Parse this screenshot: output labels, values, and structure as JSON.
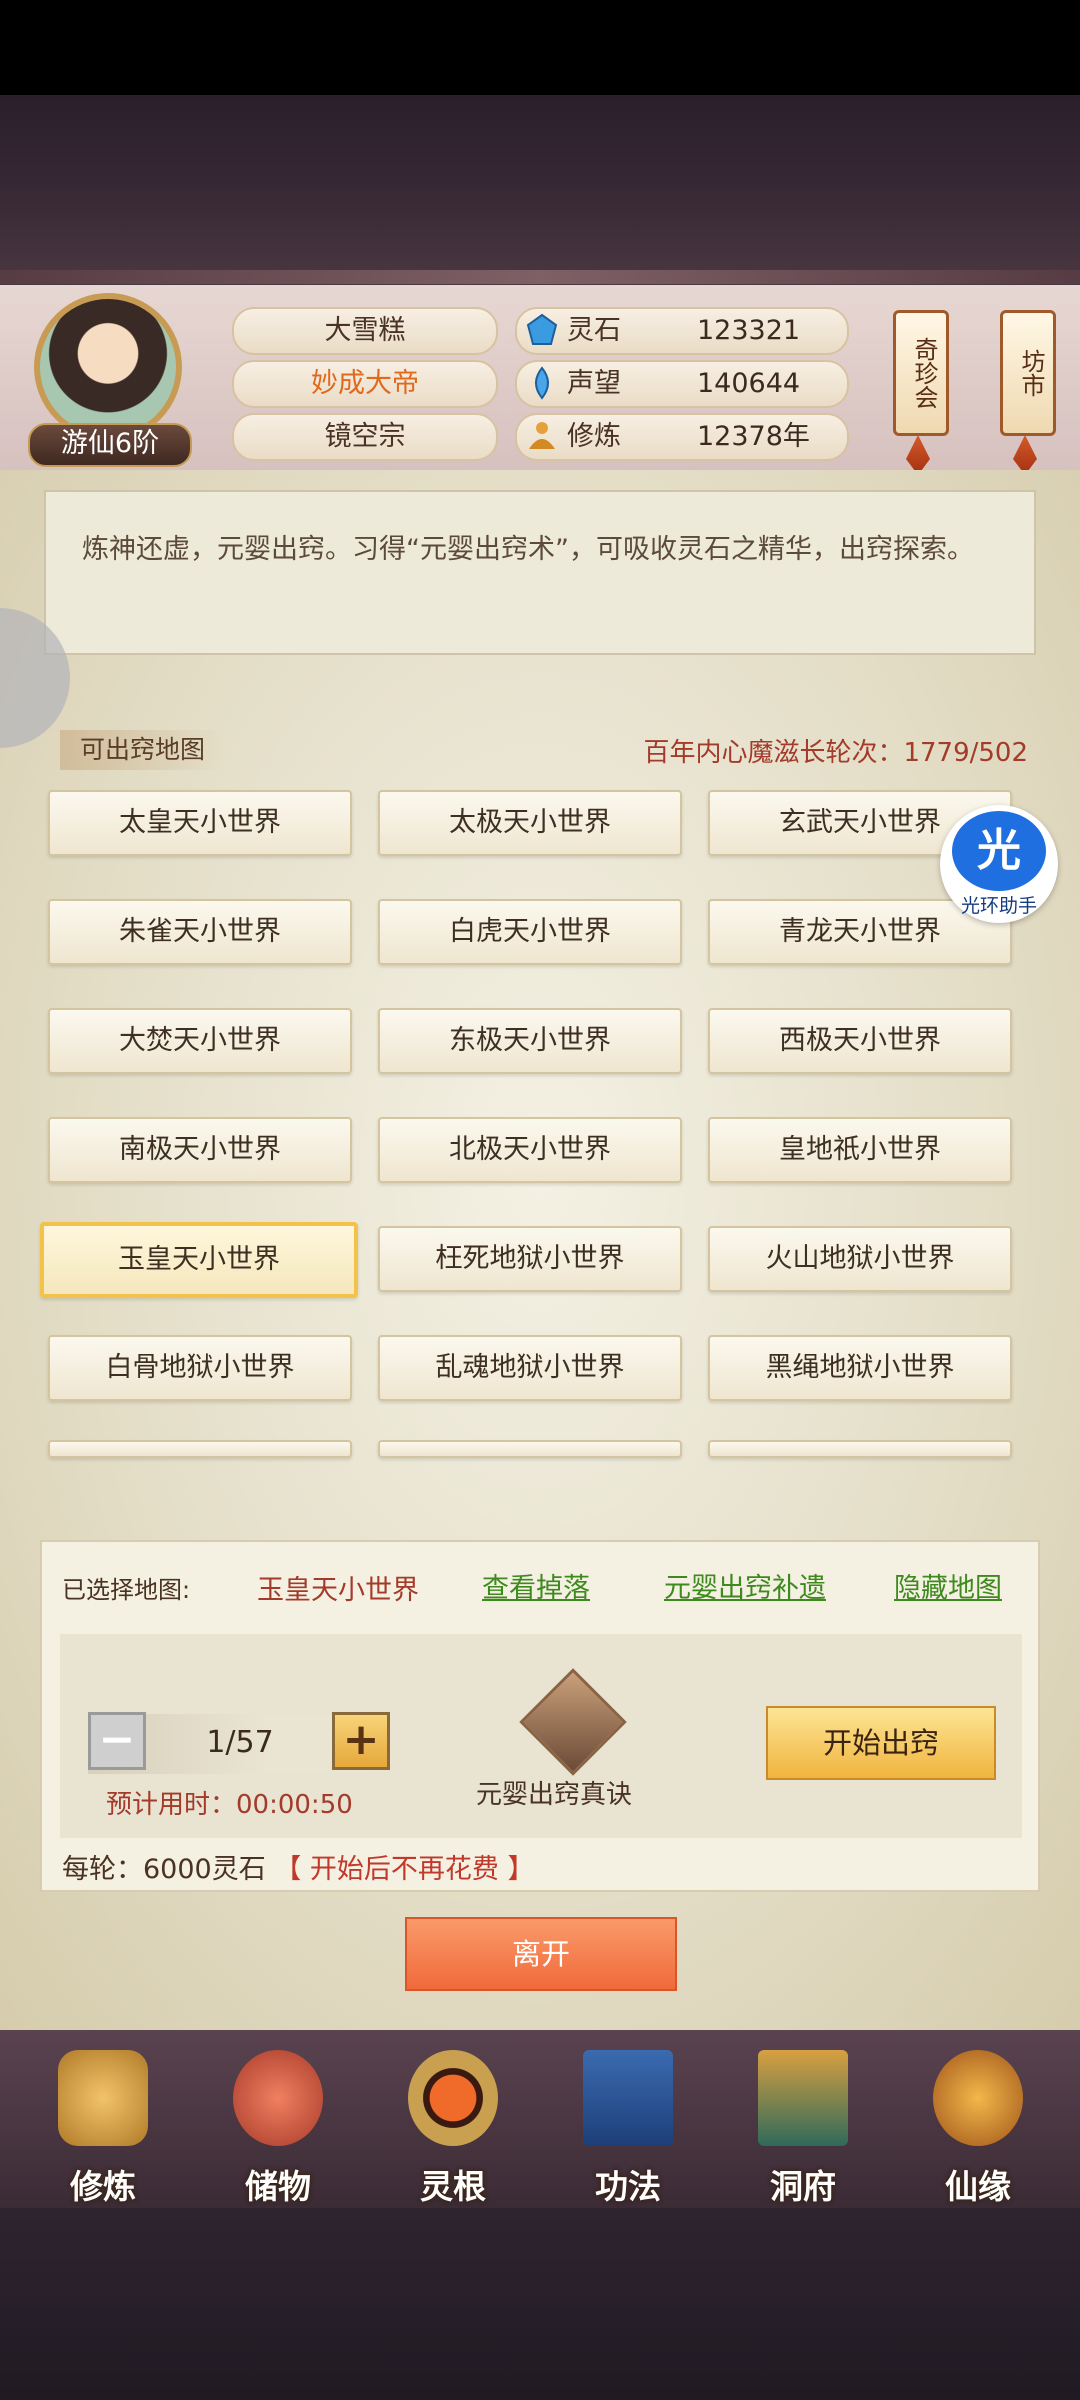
{
  "header": {
    "rank_badge": "游仙6阶",
    "player_name": "大雪糕",
    "title": "妙成大帝",
    "sect": "镜空宗",
    "resources": [
      {
        "label": "灵石",
        "value": "123321",
        "icon": "spirit-stone-icon"
      },
      {
        "label": "声望",
        "value": "140644",
        "icon": "prestige-icon"
      },
      {
        "label": "修炼",
        "value": "12378年",
        "icon": "cultivation-icon"
      }
    ],
    "shop_buttons": [
      "奇珍会",
      "坊市"
    ]
  },
  "intro_text": "炼神还虚，元婴出窍。习得“元婴出窍术”，可吸收灵石之精华，出窍探索。",
  "maps": {
    "section_title": "可出窍地图",
    "counter_label": "百年内心魔滋长轮次：1779/502",
    "items": [
      "太皇天小世界",
      "太极天小世界",
      "玄武天小世界",
      "朱雀天小世界",
      "白虎天小世界",
      "青龙天小世界",
      "大焚天小世界",
      "东极天小世界",
      "西极天小世界",
      "南极天小世界",
      "北极天小世界",
      "皇地祇小世界",
      "玉皇天小世界",
      "枉死地狱小世界",
      "火山地狱小世界",
      "白骨地狱小世界",
      "乱魂地狱小世界",
      "黑绳地狱小世界"
    ],
    "selected_index": 12
  },
  "helper": {
    "glyph": "光",
    "caption": "光环助手"
  },
  "control": {
    "selected_label": "已选择地图:",
    "selected_value": "玉皇天小世界",
    "links": [
      "查看掉落",
      "元婴出窍补遗",
      "隐藏地图"
    ],
    "minus": "−",
    "plus": "+",
    "quantity": "1/57",
    "eta": "预计用时：00:00:50",
    "book_label": "元婴出窍真诀",
    "start_button": "开始出窍",
    "cost_prefix": "每轮：6000灵石",
    "cost_note": "【 开始后不再花费 】"
  },
  "leave_button": "离开",
  "bottom_nav": [
    "修炼",
    "储物",
    "灵根",
    "功法",
    "洞府",
    "仙缘"
  ],
  "colors": {
    "accent_red": "#a33a2a",
    "link_green": "#3f8a1f",
    "gold": "#f2c24a"
  }
}
